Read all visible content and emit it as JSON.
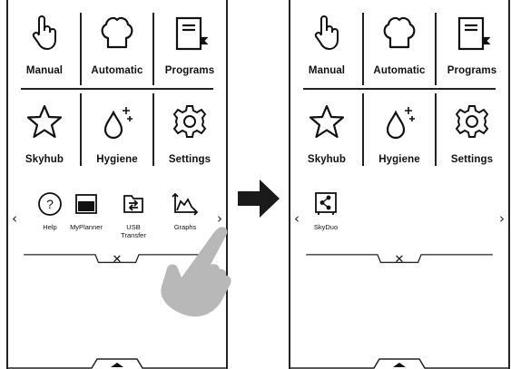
{
  "left_screen": {
    "tiles": [
      "Manual",
      "Automatic",
      "Programs",
      "Skyhub",
      "Hygiene",
      "Settings"
    ],
    "sub_items": [
      {
        "label": "Help",
        "icon": "help-icon"
      },
      {
        "label": "MyPlanner",
        "icon": "myplanner-icon"
      },
      {
        "label": "USB\nTransfer",
        "icon": "usb-transfer-icon"
      },
      {
        "label": "Graphs",
        "icon": "graphs-icon"
      }
    ],
    "prev_glyph": "‹",
    "next_glyph": "›",
    "close_glyph": "✕"
  },
  "right_screen": {
    "tiles": [
      "Manual",
      "Automatic",
      "Programs",
      "Skyhub",
      "Hygiene",
      "Settings"
    ],
    "sub_items": [
      {
        "label": "SkyDuo",
        "icon": "skyduo-icon"
      }
    ],
    "prev_glyph": "‹",
    "next_glyph": "›",
    "close_glyph": "✕"
  },
  "colors": {
    "line": "#222222",
    "hand": "#b8b8b8",
    "arrow": "#1a1a1a"
  }
}
